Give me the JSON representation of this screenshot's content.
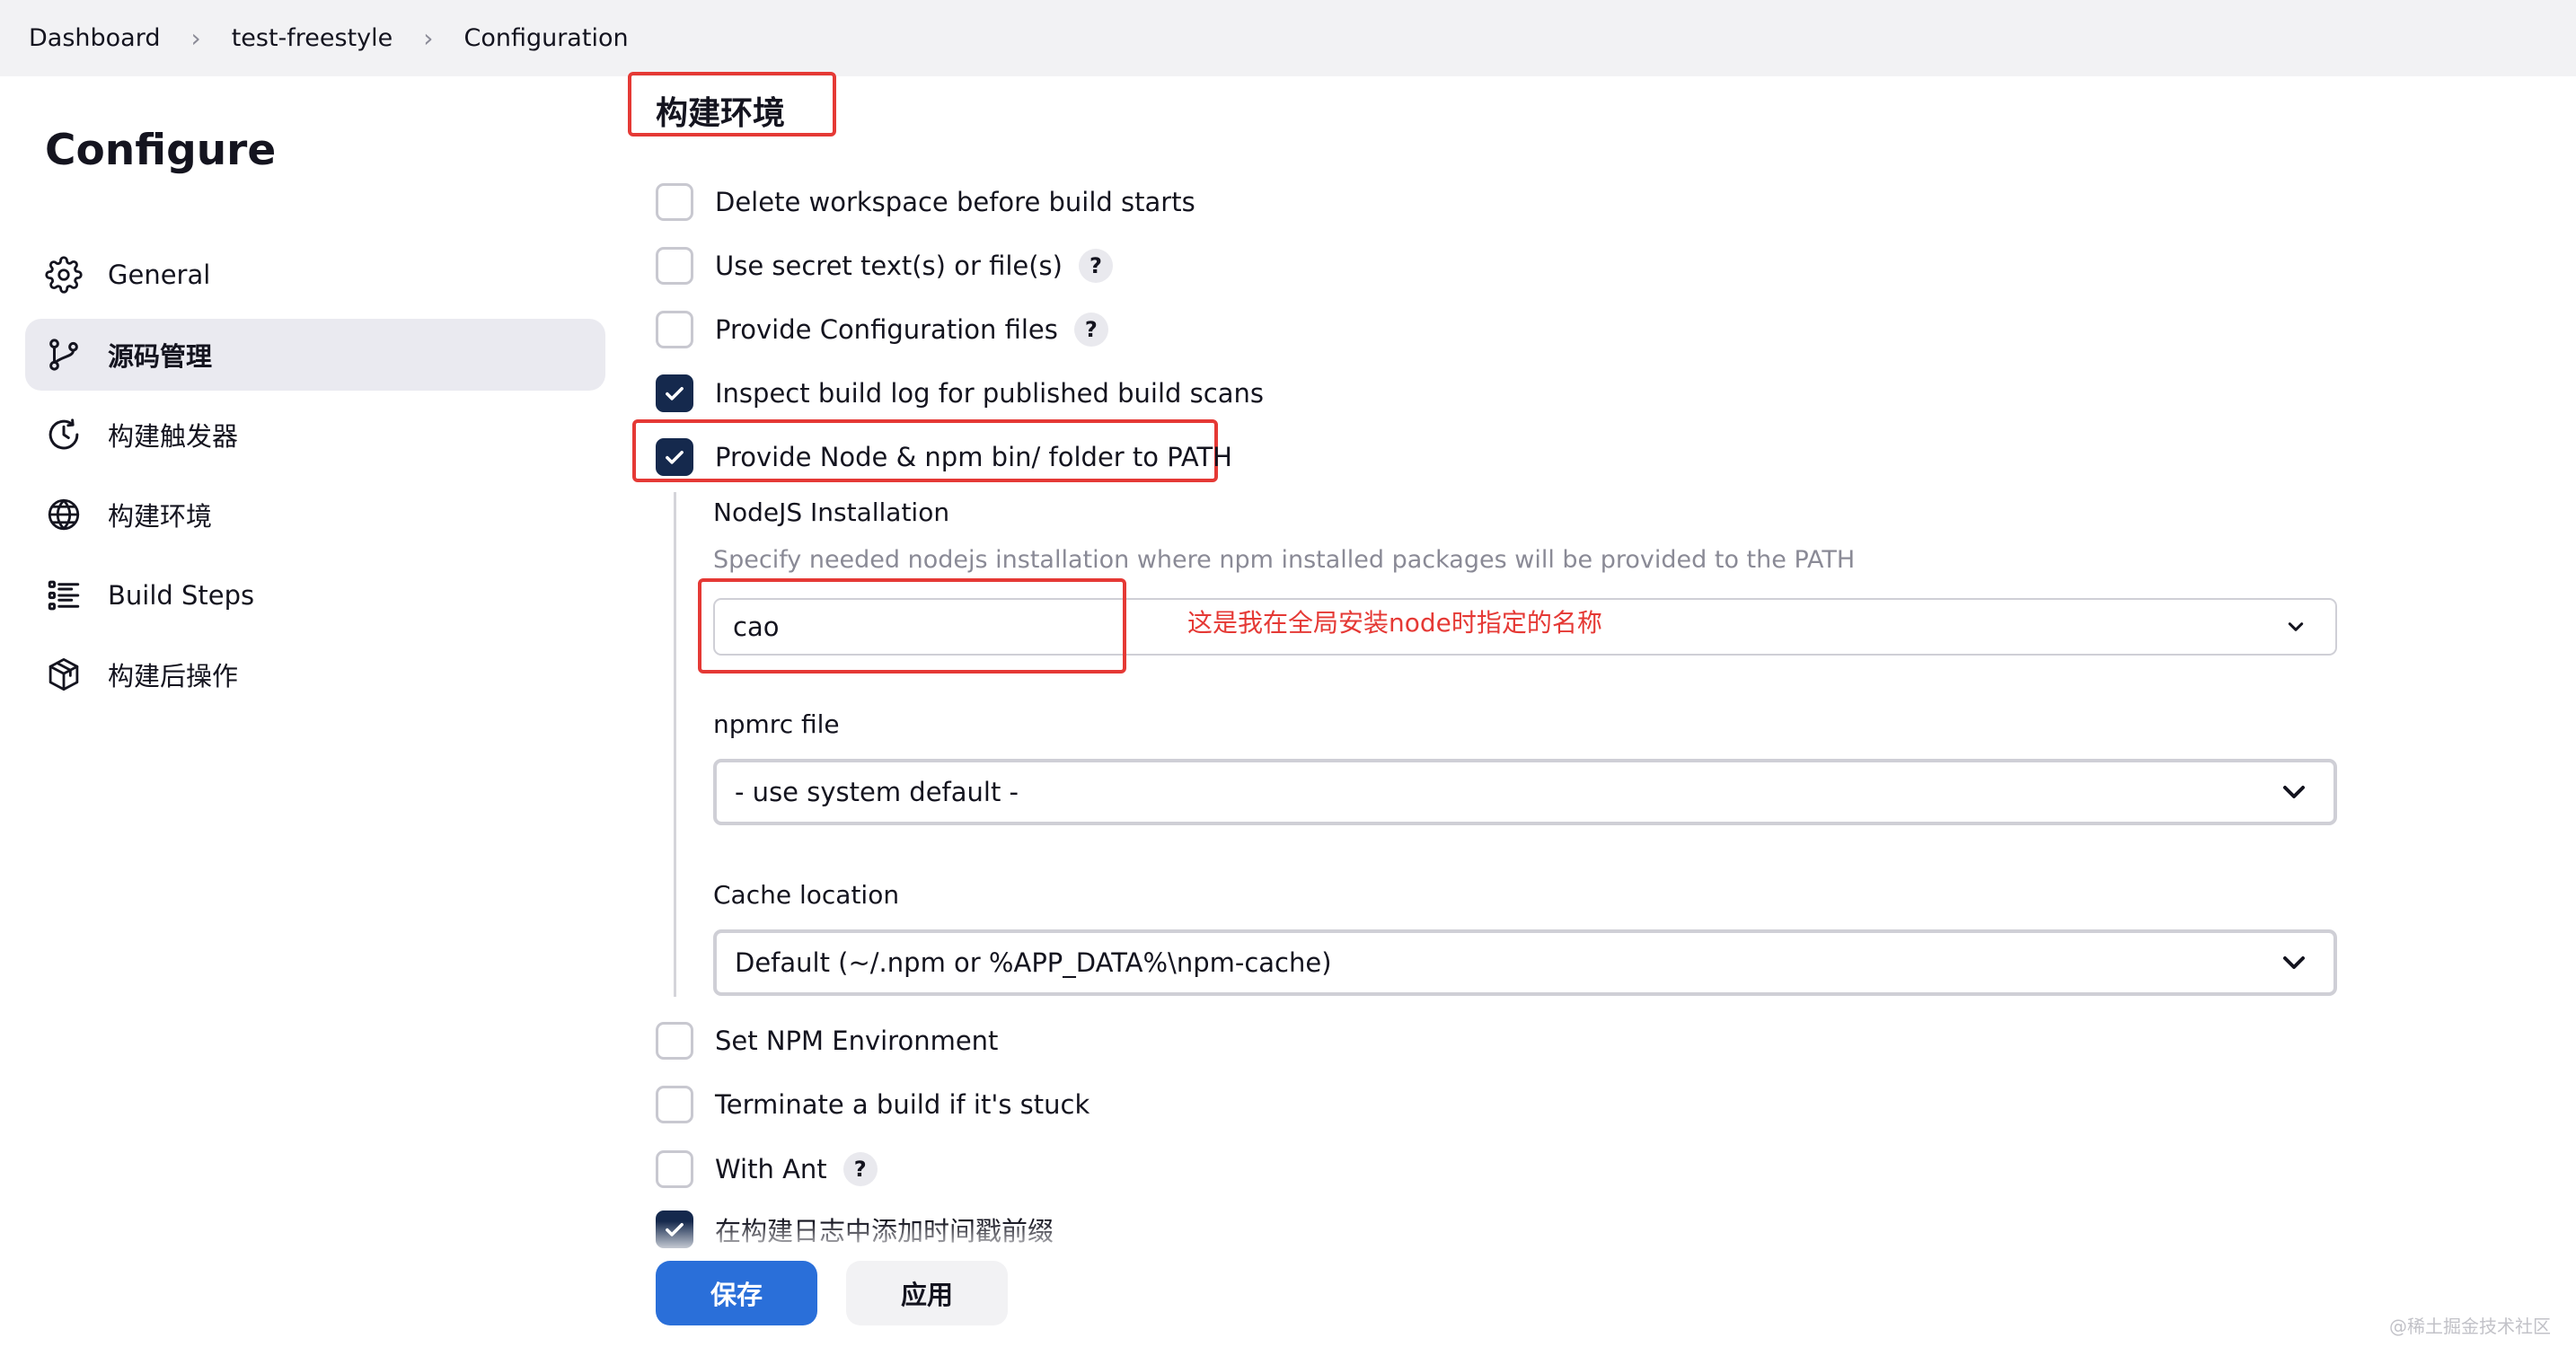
{
  "breadcrumb": {
    "items": [
      "Dashboard",
      "test-freestyle",
      "Configuration"
    ]
  },
  "sidebar": {
    "title": "Configure",
    "items": [
      {
        "label": "General",
        "icon": "gear-icon"
      },
      {
        "label": "源码管理",
        "icon": "source-branch-icon",
        "active": true
      },
      {
        "label": "构建触发器",
        "icon": "clock-icon"
      },
      {
        "label": "构建环境",
        "icon": "globe-icon"
      },
      {
        "label": "Build Steps",
        "icon": "list-icon"
      },
      {
        "label": "构建后操作",
        "icon": "package-icon"
      }
    ]
  },
  "main": {
    "section_title": "构建环境",
    "options": [
      {
        "label": "Delete workspace before build starts",
        "checked": false,
        "help": false
      },
      {
        "label": "Use secret text(s) or file(s)",
        "checked": false,
        "help": true
      },
      {
        "label": "Provide Configuration files",
        "checked": false,
        "help": true
      },
      {
        "label": "Inspect build log for published build scans",
        "checked": true,
        "help": false
      },
      {
        "label": "Provide Node & npm bin/ folder to PATH",
        "checked": true,
        "help": false
      }
    ],
    "node": {
      "installation_label": "NodeJS Installation",
      "installation_desc": "Specify needed nodejs installation where npm installed packages will be provided to the PATH",
      "installation_value": "cao",
      "npmrc_label": "npmrc file",
      "npmrc_value": "- use system default -",
      "cache_label": "Cache location",
      "cache_value": "Default (~/.npm or %APP_DATA%\\npm-cache)"
    },
    "more_options": [
      {
        "label": "Set NPM Environment",
        "checked": false,
        "help": false
      },
      {
        "label": "Terminate a build if it's stuck",
        "checked": false,
        "help": false
      },
      {
        "label": "With Ant",
        "checked": false,
        "help": true
      },
      {
        "label": "在构建日志中添加时间戳前缀",
        "checked": true,
        "help": false
      }
    ],
    "help_glyph": "?"
  },
  "annotation": "这是我在全局安装node时指定的名称",
  "buttons": {
    "save": "保存",
    "apply": "应用"
  },
  "watermark": "@稀土掘金技术社区",
  "colors": {
    "accent": "#2a6fd9",
    "checked": "#15294d",
    "annotation_red": "#e53935"
  }
}
